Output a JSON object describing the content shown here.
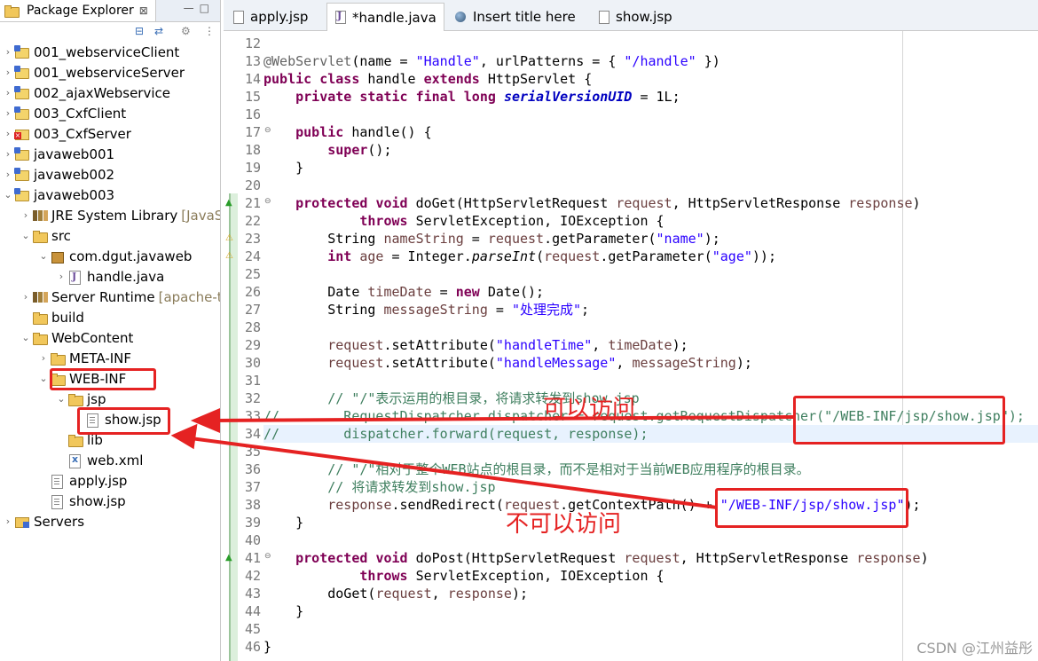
{
  "explorer": {
    "title": "Package Explorer",
    "tree": [
      {
        "label": "001_webserviceClient",
        "icon": "project-icon"
      },
      {
        "label": "001_webserviceServer",
        "icon": "project-icon"
      },
      {
        "label": "002_ajaxWebservice",
        "icon": "project-icon"
      },
      {
        "label": "003_CxfClient",
        "icon": "project-icon"
      },
      {
        "label": "003_CxfServer",
        "icon": "project-error-icon"
      },
      {
        "label": "javaweb001",
        "icon": "project-icon"
      },
      {
        "label": "javaweb002",
        "icon": "project-icon"
      },
      {
        "label": "javaweb003",
        "icon": "project-icon"
      },
      {
        "label": "JRE System Library",
        "suffix": "[JavaSE",
        "icon": "library-icon"
      },
      {
        "label": "src",
        "icon": "source-folder-icon"
      },
      {
        "label": "com.dgut.javaweb",
        "icon": "package-icon"
      },
      {
        "label": "handle.java",
        "icon": "java-file-icon"
      },
      {
        "label": "Server Runtime",
        "suffix": "[apache-tc",
        "icon": "library-icon"
      },
      {
        "label": "build",
        "icon": "folder-icon"
      },
      {
        "label": "WebContent",
        "icon": "folder-icon"
      },
      {
        "label": "META-INF",
        "icon": "folder-icon"
      },
      {
        "label": "WEB-INF",
        "icon": "folder-icon"
      },
      {
        "label": "jsp",
        "icon": "folder-icon"
      },
      {
        "label": "show.jsp",
        "icon": "file-icon"
      },
      {
        "label": "lib",
        "icon": "folder-icon"
      },
      {
        "label": "web.xml",
        "icon": "xml-file-icon"
      },
      {
        "label": "apply.jsp",
        "icon": "file-icon"
      },
      {
        "label": "show.jsp",
        "icon": "file-icon"
      },
      {
        "label": "Servers",
        "icon": "server-folder-icon"
      }
    ]
  },
  "tabs": [
    {
      "label": "apply.jsp",
      "icon": "jsp-file-icon"
    },
    {
      "label": "*handle.java",
      "icon": "java-file-icon"
    },
    {
      "label": "Insert title here",
      "icon": "browser-globe-icon"
    },
    {
      "label": "show.jsp",
      "icon": "jsp-file-icon"
    }
  ],
  "code": [
    {
      "n": "12",
      "html": ""
    },
    {
      "n": "13",
      "html": "<span class=\"ann\">@WebServlet</span>(name = <span class=\"str\">\"Handle\"</span>, urlPatterns = { <span class=\"str\">\"/handle\"</span> })"
    },
    {
      "n": "14",
      "html": "<span class=\"kw\">public</span> <span class=\"kw\">class</span> handle <span class=\"kw\">extends</span> HttpServlet {"
    },
    {
      "n": "15",
      "html": "    <span class=\"kw\">private</span> <span class=\"kw\">static</span> <span class=\"kw\">final</span> <span class=\"kw\">long</span> <span class=\"fld\">serialVersionUID</span> = 1L;"
    },
    {
      "n": "16",
      "html": ""
    },
    {
      "n": "17",
      "html": "    <span class=\"kw\">public</span> handle() {",
      "fold": "⊖"
    },
    {
      "n": "18",
      "html": "        <span class=\"kw\">super</span>();"
    },
    {
      "n": "19",
      "html": "    }"
    },
    {
      "n": "20",
      "html": ""
    },
    {
      "n": "21",
      "html": "    <span class=\"kw\">protected</span> <span class=\"kw\">void</span> doGet(HttpServletRequest <span class=\"var\">request</span>, HttpServletResponse <span class=\"var\">response</span>)",
      "fold": "⊖",
      "mark": "▲"
    },
    {
      "n": "22",
      "html": "            <span class=\"kw\">throws</span> ServletException, IOException {"
    },
    {
      "n": "23",
      "html": "        String <span class=\"var\">nameString</span> = <span class=\"var\">request</span>.getParameter(<span class=\"str\">\"name\"</span>);",
      "mark": "⚠"
    },
    {
      "n": "24",
      "html": "        <span class=\"kw\">int</span> <span class=\"var\">age</span> = Integer.<span class=\"ital\">parseInt</span>(<span class=\"var\">request</span>.getParameter(<span class=\"str\">\"age\"</span>));",
      "mark": "⚠"
    },
    {
      "n": "25",
      "html": ""
    },
    {
      "n": "26",
      "html": "        Date <span class=\"var\">timeDate</span> = <span class=\"kw\">new</span> Date();"
    },
    {
      "n": "27",
      "html": "        String <span class=\"var\">messageString</span> = <span class=\"str\">\"处理完成\"</span>;"
    },
    {
      "n": "28",
      "html": ""
    },
    {
      "n": "29",
      "html": "        <span class=\"var\">request</span>.setAttribute(<span class=\"str\">\"handleTime\"</span>, <span class=\"var\">timeDate</span>);"
    },
    {
      "n": "30",
      "html": "        <span class=\"var\">request</span>.setAttribute(<span class=\"str\">\"handleMessage\"</span>, <span class=\"var\">messageString</span>);"
    },
    {
      "n": "31",
      "html": ""
    },
    {
      "n": "32",
      "html": "        <span class=\"cmt\">// \"/\"表示运用的根目录，将请求转发到show.jsp</span>"
    },
    {
      "n": "33",
      "html": "<span class=\"cmt\">//        RequestDispatcher dispatcher = request.getRequestDispatcher(\"/WEB-INF/jsp/show.jsp\");</span>"
    },
    {
      "n": "34",
      "html": "<span class=\"cmt\">//        dispatcher.forward(request, response);</span>",
      "highlight": true
    },
    {
      "n": "35",
      "html": ""
    },
    {
      "n": "36",
      "html": "        <span class=\"cmt\">// \"/\"相对于整个WEB站点的根目录，而不是相对于当前WEB应用程序的根目录。</span>"
    },
    {
      "n": "37",
      "html": "        <span class=\"cmt\">// 将请求转发到show.jsp</span>"
    },
    {
      "n": "38",
      "html": "        <span class=\"var\">response</span>.sendRedirect(<span class=\"var\">request</span>.getContextPath() + <span class=\"str\">\"/WEB-INF/jsp/show.jsp\"</span>);"
    },
    {
      "n": "39",
      "html": "    }"
    },
    {
      "n": "40",
      "html": ""
    },
    {
      "n": "41",
      "html": "    <span class=\"kw\">protected</span> <span class=\"kw\">void</span> doPost(HttpServletRequest <span class=\"var\">request</span>, HttpServletResponse <span class=\"var\">response</span>)",
      "fold": "⊖",
      "mark": "▲"
    },
    {
      "n": "42",
      "html": "            <span class=\"kw\">throws</span> ServletException, IOException {"
    },
    {
      "n": "43",
      "html": "        doGet(<span class=\"var\">request</span>, <span class=\"var\">response</span>);"
    },
    {
      "n": "44",
      "html": "    }"
    },
    {
      "n": "45",
      "html": ""
    },
    {
      "n": "46",
      "html": "}"
    }
  ],
  "annotations": {
    "accessible": "可以访问",
    "not_accessible": "不可以访问"
  },
  "watermark": "CSDN @江州益彤",
  "colors": {
    "annotation_red": "#e52222",
    "keyword": "#7f0055",
    "string": "#2a00ff",
    "comment": "#3f7f5f"
  }
}
